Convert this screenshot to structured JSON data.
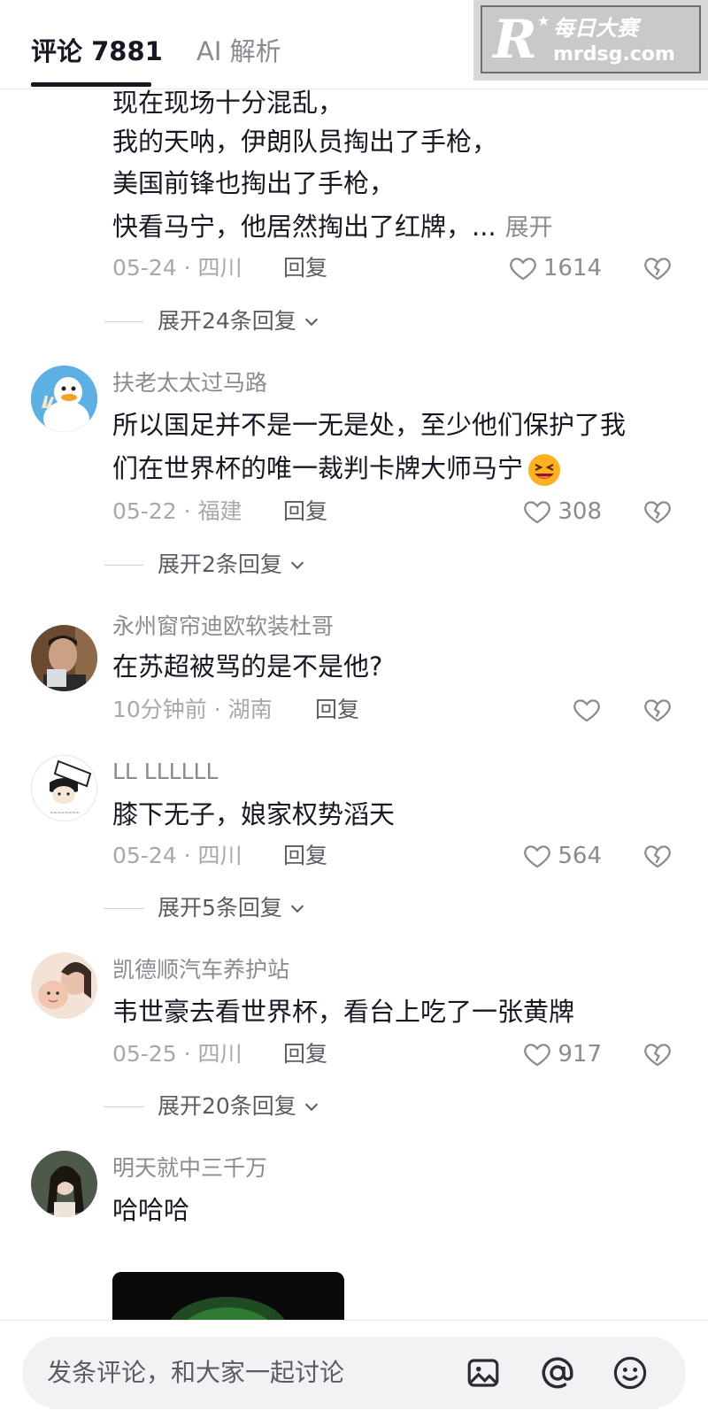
{
  "tabs": {
    "comments": "评论 7881",
    "ai": "AI 解析"
  },
  "watermark": {
    "cn": "每日大赛",
    "url": "mrdsg.com"
  },
  "comment0": {
    "lines": [
      "现在现场十分混乱，",
      "我的天呐，伊朗队员掏出了手枪，",
      "美国前锋也掏出了手枪，",
      "快看马宁，他居然掏出了红牌，..."
    ],
    "expand_label": "展开",
    "date": "05-24",
    "location": "四川",
    "likes": "1614",
    "replies": "展开24条回复"
  },
  "comment1": {
    "user": "扶老太太过马路",
    "lines": [
      "所以国足并不是一无是处，至少他们保护了我",
      "们在世界杯的唯一裁判卡牌大师马宁"
    ],
    "date": "05-22",
    "location": "福建",
    "likes": "308",
    "replies": "展开2条回复"
  },
  "comment2": {
    "user": "永州窗帘迪欧软装杜哥",
    "lines": [
      "在苏超被骂的是不是他?"
    ],
    "date": "10分钟前",
    "location": "湖南"
  },
  "comment3": {
    "user": "LL LLLLLL",
    "lines": [
      "膝下无子，娘家权势滔天"
    ],
    "date": "05-24",
    "location": "四川",
    "likes": "564",
    "replies": "展开5条回复"
  },
  "comment4": {
    "user": "凯德顺汽车养护站",
    "lines": [
      "韦世豪去看世界杯，看台上吃了一张黄牌"
    ],
    "date": "05-25",
    "location": "四川",
    "likes": "917",
    "replies": "展开20条回复"
  },
  "comment5": {
    "user": "明天就中三千万",
    "lines": [
      "哈哈哈"
    ]
  },
  "common": {
    "reply_label": "回复",
    "separator": "·"
  },
  "input": {
    "placeholder": "发条评论，和大家一起讨论"
  },
  "icons": [
    "heart-icon",
    "broken-heart-icon",
    "chevron-down-icon",
    "image-icon",
    "at-icon",
    "emoji-icon",
    "laughing-emoji-icon"
  ],
  "colors": {
    "text": "#161823",
    "secondary": "#8a8b91",
    "background": "#ffffff"
  }
}
